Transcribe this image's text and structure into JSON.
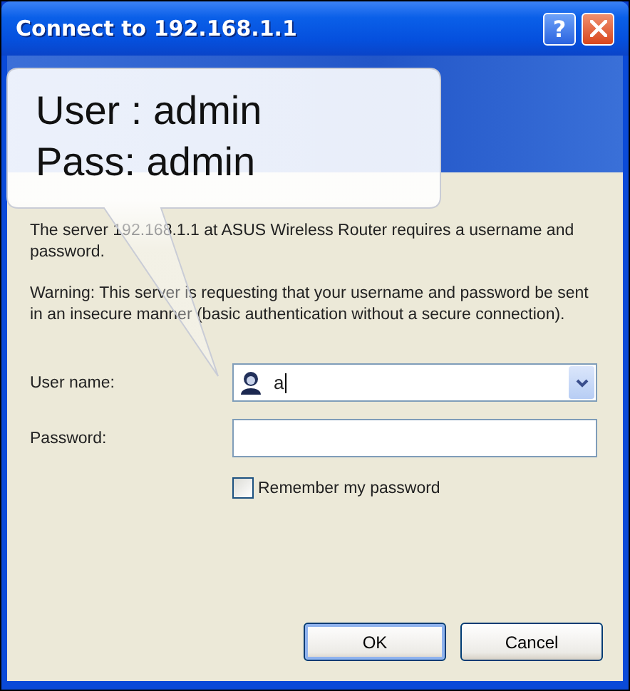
{
  "window": {
    "title": "Connect to 192.168.1.1",
    "controls": [
      {
        "kind": "help",
        "label": "?"
      },
      {
        "kind": "close"
      }
    ]
  },
  "callout": {
    "lines": [
      "User : admin",
      "Pass: admin"
    ]
  },
  "message": "The server 192.168.1.1 at ASUS Wireless Router requires a username and password.",
  "warning": "Warning: This server is requesting that your username and password be sent in an insecure manner (basic authentication without a secure connection).",
  "fields": [
    {
      "kind": "combo",
      "label": "User name:",
      "value": "a"
    },
    {
      "kind": "password",
      "label": "Password:"
    }
  ],
  "remember": {
    "label": "Remember my password",
    "checked": false
  },
  "buttons": [
    {
      "label": "OK",
      "default": true
    },
    {
      "label": "Cancel",
      "default": false
    }
  ]
}
